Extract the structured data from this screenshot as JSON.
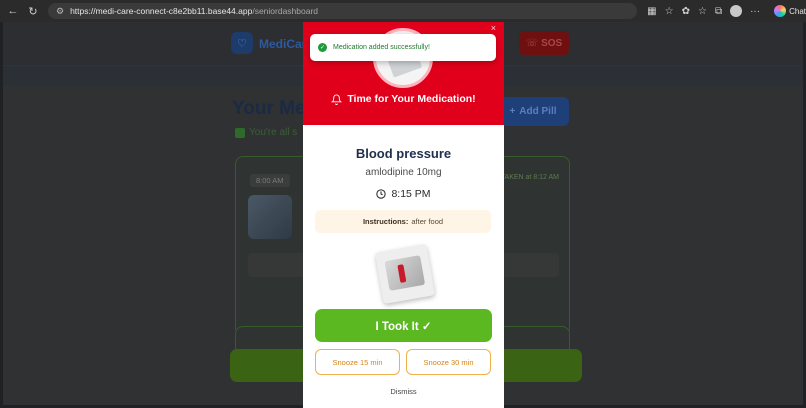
{
  "browser": {
    "url_host": "https://medi-care-connect-c8e2bb11.base44.app",
    "url_path": "/seniordashboard",
    "chat_label": "Chat"
  },
  "background": {
    "logo_text": "MediCare",
    "sos_label": "SOS",
    "title": "Your Me",
    "add_pill_label": "Add Pill",
    "all_set_text": "You're all s",
    "card_time": "8:00 AM",
    "card_taken": "TAKEN at 8:12 AM"
  },
  "toast": {
    "message": "Medication added successfully!"
  },
  "modal": {
    "close_symbol": "×",
    "heading": "Time for Your Medication!",
    "medication_name": "Blood pressure",
    "dose": "amlodipine 10mg",
    "time": "8:15 PM",
    "instructions_label": "Instructions:",
    "instructions_text": "after food",
    "took_it_label": "I Took It ✓",
    "snooze_15_label": "Snooze 15 min",
    "snooze_30_label": "Snooze 30 min",
    "dismiss_label": "Dismiss"
  },
  "colors": {
    "modal_header": "#e0001b",
    "took_button": "#5bb820",
    "snooze_border": "#f0b04a",
    "toast_text": "#1d7a2e"
  }
}
